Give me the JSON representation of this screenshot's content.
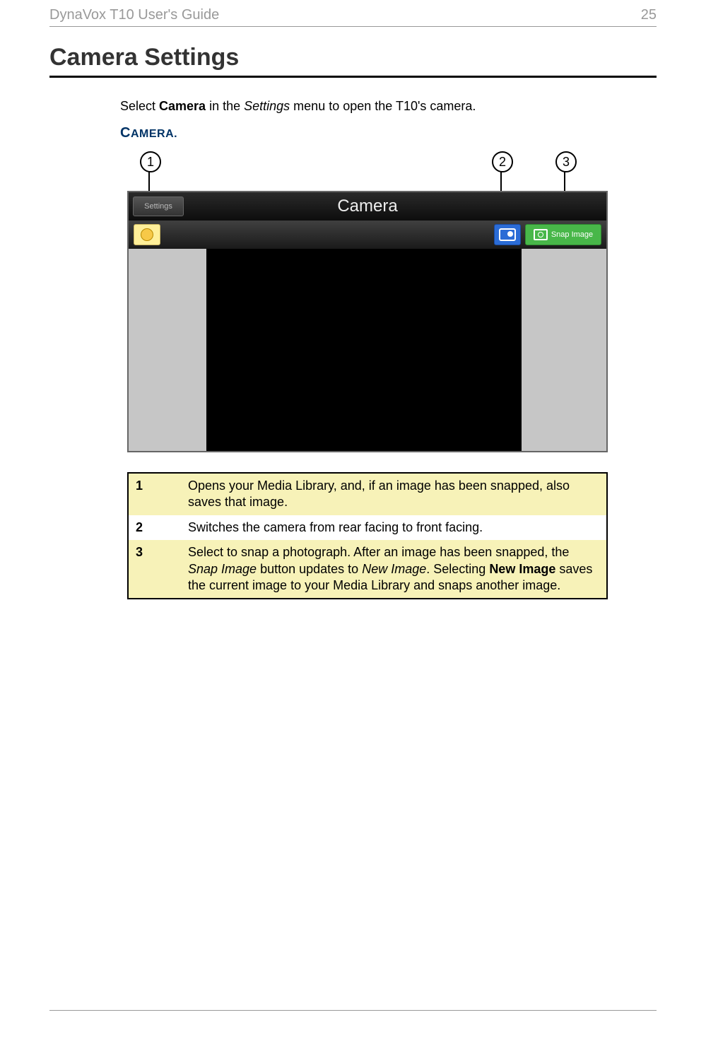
{
  "header": {
    "guide_title": "DynaVox T10 User's Guide",
    "page_number": "25"
  },
  "section_title": "Camera Settings",
  "intro": {
    "select_text": "Select ",
    "camera_bold": "Camera",
    "in_the": " in the ",
    "settings_italic": "Settings",
    "rest": " menu to open the T10's camera."
  },
  "sub_heading": {
    "c": "C",
    "rest": "AMERA."
  },
  "callouts": [
    "1",
    "2",
    "3"
  ],
  "figure": {
    "title": "Camera",
    "back_button": "Settings",
    "snap_button": "Snap Image"
  },
  "table": {
    "rows": [
      {
        "num": "1",
        "text": "Opens your Media Library, and, if an image has been snapped, also saves that image."
      },
      {
        "num": "2",
        "text": "Switches the camera from rear facing to front facing."
      },
      {
        "num": "3",
        "text_pre": "Select to snap a photograph. After an image has been snapped, the ",
        "snap_image_italic": "Snap Image",
        "text_mid": " button updates to ",
        "new_image_italic": "New Image",
        "text_mid2": ". Selecting ",
        "new_image_bold": "New Image",
        "text_post": " saves the current image to your Media Library and snaps another image."
      }
    ]
  }
}
